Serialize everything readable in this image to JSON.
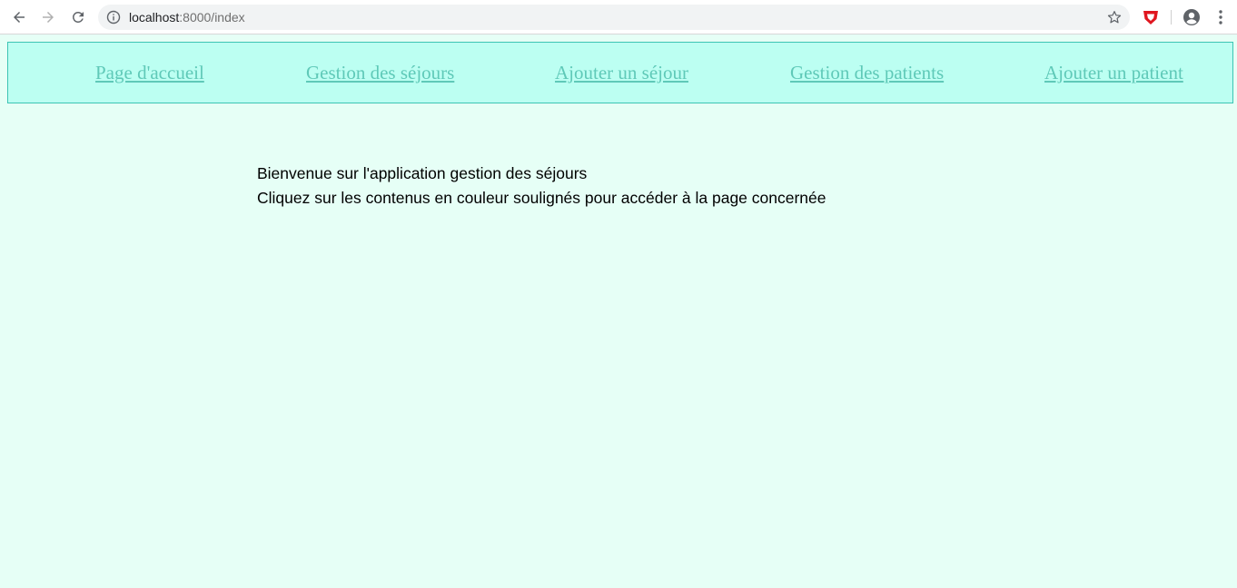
{
  "browser": {
    "url_host": "localhost",
    "url_rest": ":8000/index"
  },
  "nav": {
    "links": [
      "Page d'accueil",
      "Gestion des séjours",
      "Ajouter un séjour",
      "Gestion des patients",
      "Ajouter un patient"
    ]
  },
  "content": {
    "line1": "Bienvenue sur l'application gestion des séjours",
    "line2": "Cliquez sur les contenus en couleur soulignés pour accéder à la page concernée"
  },
  "colors": {
    "page_background": "#e6fff6",
    "nav_background": "#bcfff2",
    "nav_border": "#3cc4b3",
    "link": "#5fc9b8"
  }
}
